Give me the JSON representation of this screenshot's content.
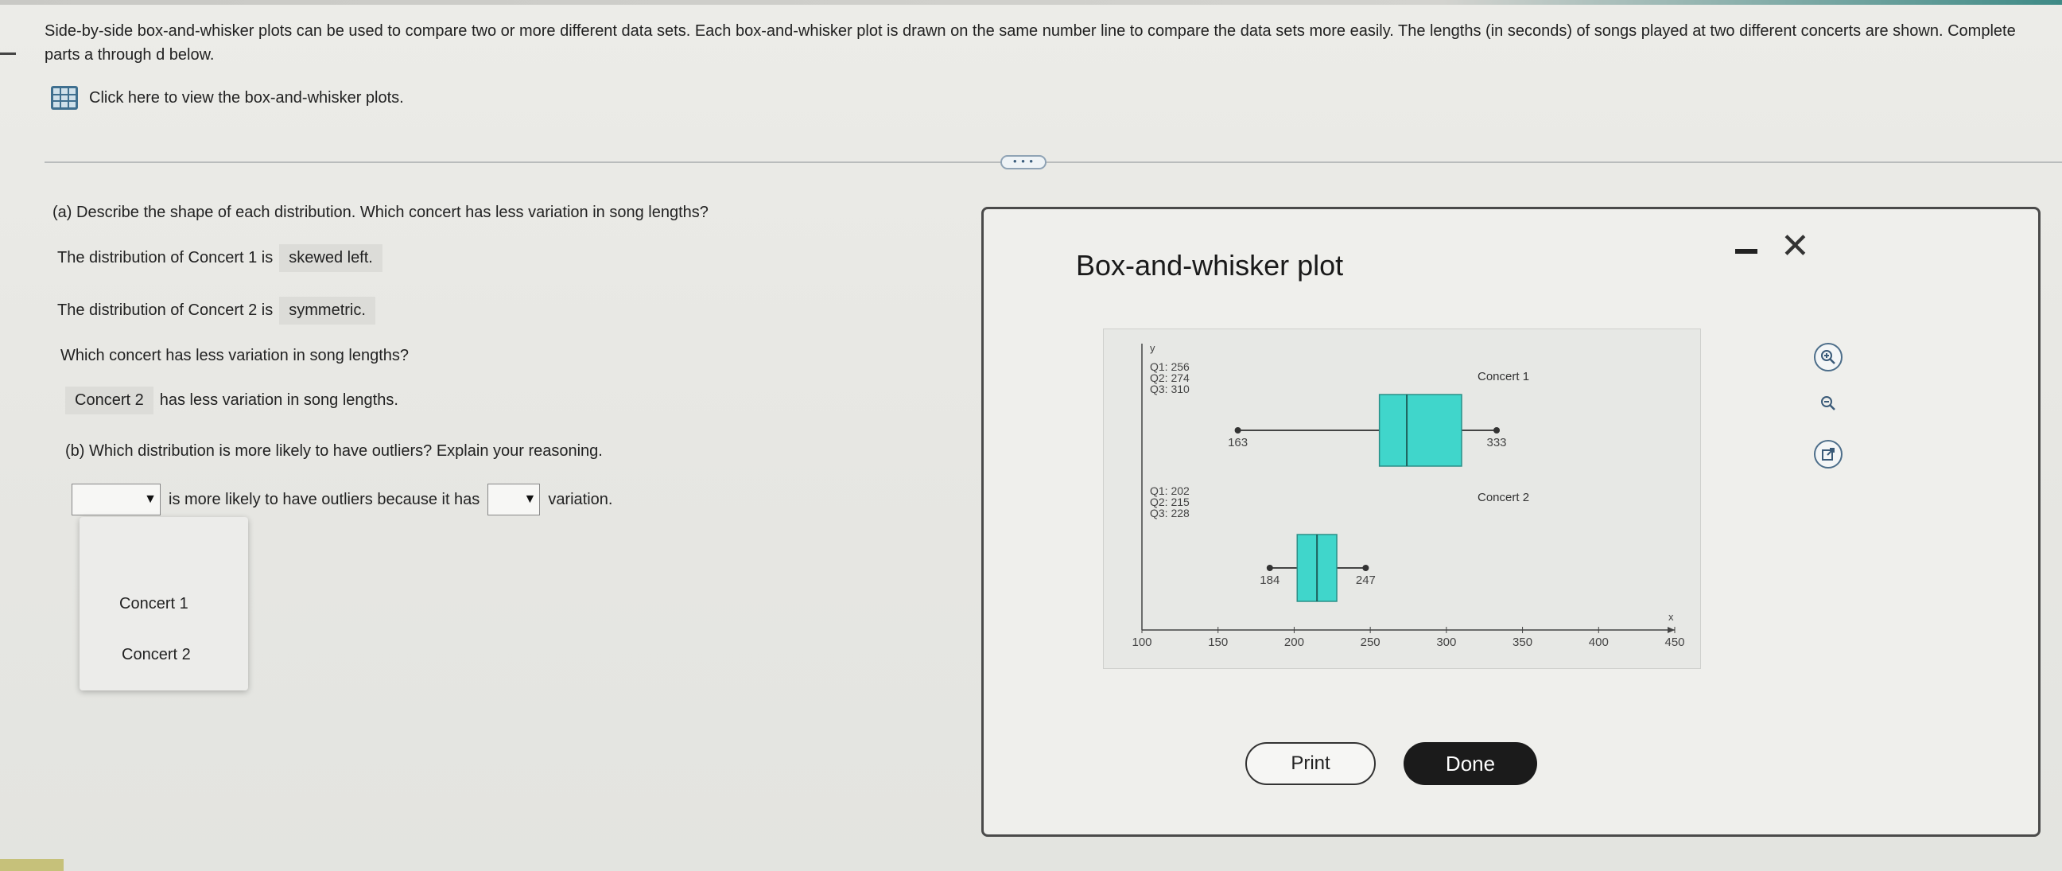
{
  "question": {
    "text": "Side-by-side box-and-whisker plots can be used to compare two or more different data sets. Each box-and-whisker plot is drawn on the same number line to compare the data sets more easily. The lengths (in seconds) of songs played at two different concerts are shown. Complete parts a through d below.",
    "link_label": "Click here to view the box-and-whisker plots.",
    "expander_label": "• • •"
  },
  "part_a": {
    "prompt": "(a) Describe the shape of each distribution. Which concert has less variation in song lengths?",
    "line1_prefix": "The distribution of Concert 1 is",
    "line1_answer": "skewed left.",
    "line2_prefix": "The distribution of Concert 2 is",
    "line2_answer": "symmetric.",
    "which_prompt": "Which concert has less variation in song lengths?",
    "line3_answer": "Concert 2",
    "line3_suffix": "has less variation in song lengths."
  },
  "part_b": {
    "prompt": "(b) Which distribution is more likely to have outliers? Explain your reasoning.",
    "middle_text": "is more likely to have outliers because it has",
    "end_text": "variation.",
    "dropdown_options": [
      "Concert 1",
      "Concert 2"
    ]
  },
  "modal": {
    "title": "Box-and-whisker plot",
    "print_label": "Print",
    "done_label": "Done"
  },
  "chart_data": {
    "type": "box",
    "title": "",
    "xlabel": "x",
    "ylabel": "y",
    "xlim": [
      100,
      450
    ],
    "x_ticks": [
      100,
      150,
      200,
      250,
      300,
      350,
      400,
      450
    ],
    "series": [
      {
        "name": "Concert 1",
        "min": 163,
        "q1": 256,
        "median": 274,
        "q3": 310,
        "max": 333,
        "stats_labels": [
          "Q1: 256",
          "Q2: 274",
          "Q3: 310"
        ]
      },
      {
        "name": "Concert 2",
        "min": 184,
        "q1": 202,
        "median": 215,
        "q3": 228,
        "max": 247,
        "stats_labels": [
          "Q1: 202",
          "Q2: 215",
          "Q3: 228"
        ]
      }
    ],
    "box_color": "#40d6cb"
  }
}
